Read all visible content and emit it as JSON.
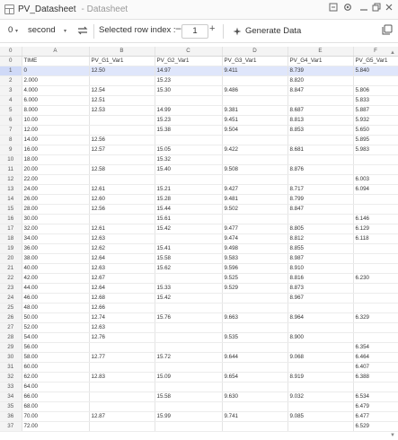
{
  "window": {
    "title": "PV_Datasheet",
    "subtitle": "- Datasheet"
  },
  "toolbar": {
    "time_value": "0",
    "time_unit": "second",
    "selected_label": "Selected row index :",
    "selected_value": "1",
    "generate_label": "Generate Data"
  },
  "table": {
    "corner": "0",
    "columns": [
      "A",
      "B",
      "C",
      "D",
      "E",
      "F"
    ],
    "rows": [
      {
        "n": "0",
        "c": [
          "TIME",
          "PV_G1_Var1",
          "PV_G2_Var1",
          "PV_G3_Var1",
          "PV_G4_Var1",
          "PV_G5_Var1"
        ]
      },
      {
        "n": "1",
        "c": [
          "0",
          "12.50",
          "14.97",
          "9.411",
          "8.739",
          "5.840"
        ]
      },
      {
        "n": "2",
        "c": [
          "2.000",
          "",
          "15.23",
          "",
          "8.820",
          ""
        ]
      },
      {
        "n": "3",
        "c": [
          "4.000",
          "12.54",
          "15.30",
          "9.486",
          "8.847",
          "5.806"
        ]
      },
      {
        "n": "4",
        "c": [
          "6.000",
          "12.51",
          "",
          "",
          "",
          "5.833"
        ]
      },
      {
        "n": "5",
        "c": [
          "8.000",
          "12.53",
          "14.99",
          "9.381",
          "8.687",
          "5.887"
        ]
      },
      {
        "n": "6",
        "c": [
          "10.00",
          "",
          "15.23",
          "9.451",
          "8.813",
          "5.932"
        ]
      },
      {
        "n": "7",
        "c": [
          "12.00",
          "",
          "15.38",
          "9.504",
          "8.853",
          "5.650"
        ]
      },
      {
        "n": "8",
        "c": [
          "14.00",
          "12.56",
          "",
          "",
          "",
          "5.895"
        ]
      },
      {
        "n": "9",
        "c": [
          "16.00",
          "12.57",
          "15.05",
          "9.422",
          "8.681",
          "5.983"
        ]
      },
      {
        "n": "10",
        "c": [
          "18.00",
          "",
          "15.32",
          "",
          "",
          ""
        ]
      },
      {
        "n": "11",
        "c": [
          "20.00",
          "12.58",
          "15.40",
          "9.508",
          "8.876",
          ""
        ]
      },
      {
        "n": "12",
        "c": [
          "22.00",
          "",
          "",
          "",
          "",
          "6.003"
        ]
      },
      {
        "n": "13",
        "c": [
          "24.00",
          "12.61",
          "15.21",
          "9.427",
          "8.717",
          "6.094"
        ]
      },
      {
        "n": "14",
        "c": [
          "26.00",
          "12.60",
          "15.28",
          "9.481",
          "8.799",
          ""
        ]
      },
      {
        "n": "15",
        "c": [
          "28.00",
          "12.56",
          "15.44",
          "9.502",
          "8.847",
          ""
        ]
      },
      {
        "n": "16",
        "c": [
          "30.00",
          "",
          "15.61",
          "",
          "",
          "6.146"
        ]
      },
      {
        "n": "17",
        "c": [
          "32.00",
          "12.61",
          "15.42",
          "9.477",
          "8.805",
          "6.129"
        ]
      },
      {
        "n": "18",
        "c": [
          "34.00",
          "12.63",
          "",
          "9.474",
          "8.812",
          "6.118"
        ]
      },
      {
        "n": "19",
        "c": [
          "36.00",
          "12.62",
          "15.41",
          "9.498",
          "8.855",
          ""
        ]
      },
      {
        "n": "20",
        "c": [
          "38.00",
          "12.64",
          "15.58",
          "9.583",
          "8.987",
          ""
        ]
      },
      {
        "n": "21",
        "c": [
          "40.00",
          "12.63",
          "15.62",
          "9.596",
          "8.910",
          ""
        ]
      },
      {
        "n": "22",
        "c": [
          "42.00",
          "12.67",
          "",
          "9.525",
          "8.816",
          "6.230"
        ]
      },
      {
        "n": "23",
        "c": [
          "44.00",
          "12.64",
          "15.33",
          "9.529",
          "8.873",
          ""
        ]
      },
      {
        "n": "24",
        "c": [
          "46.00",
          "12.68",
          "15.42",
          "",
          "8.967",
          ""
        ]
      },
      {
        "n": "25",
        "c": [
          "48.00",
          "12.66",
          "",
          "",
          "",
          ""
        ]
      },
      {
        "n": "26",
        "c": [
          "50.00",
          "12.74",
          "15.76",
          "9.663",
          "8.964",
          "6.329"
        ]
      },
      {
        "n": "27",
        "c": [
          "52.00",
          "12.63",
          "",
          "",
          "",
          ""
        ]
      },
      {
        "n": "28",
        "c": [
          "54.00",
          "12.76",
          "",
          "9.535",
          "8.900",
          ""
        ]
      },
      {
        "n": "29",
        "c": [
          "56.00",
          "",
          "",
          "",
          "",
          "6.354"
        ]
      },
      {
        "n": "30",
        "c": [
          "58.00",
          "12.77",
          "15.72",
          "9.644",
          "9.068",
          "6.464"
        ]
      },
      {
        "n": "31",
        "c": [
          "60.00",
          "",
          "",
          "",
          "",
          "6.407"
        ]
      },
      {
        "n": "32",
        "c": [
          "62.00",
          "12.83",
          "15.09",
          "9.654",
          "8.919",
          "6.388"
        ]
      },
      {
        "n": "33",
        "c": [
          "64.00",
          "",
          "",
          "",
          "",
          ""
        ]
      },
      {
        "n": "34",
        "c": [
          "66.00",
          "",
          "15.58",
          "9.630",
          "9.032",
          "6.534"
        ]
      },
      {
        "n": "35",
        "c": [
          "68.00",
          "",
          "",
          "",
          "",
          "6.479"
        ]
      },
      {
        "n": "36",
        "c": [
          "70.00",
          "12.87",
          "15.99",
          "9.741",
          "9.085",
          "6.477"
        ]
      },
      {
        "n": "37",
        "c": [
          "72.00",
          "",
          "",
          "",
          "",
          "6.529"
        ]
      }
    ]
  },
  "colors": {
    "selected_row": "#dfe6fb",
    "header_bg": "#f4f4f4",
    "grid_line": "#e4e4e4"
  },
  "icons": [
    "table-icon",
    "minimize-icon",
    "gear-icon",
    "restore-icon",
    "close-icon",
    "swap-icon",
    "generate-icon",
    "copy-icon",
    "dropdown-icon"
  ]
}
